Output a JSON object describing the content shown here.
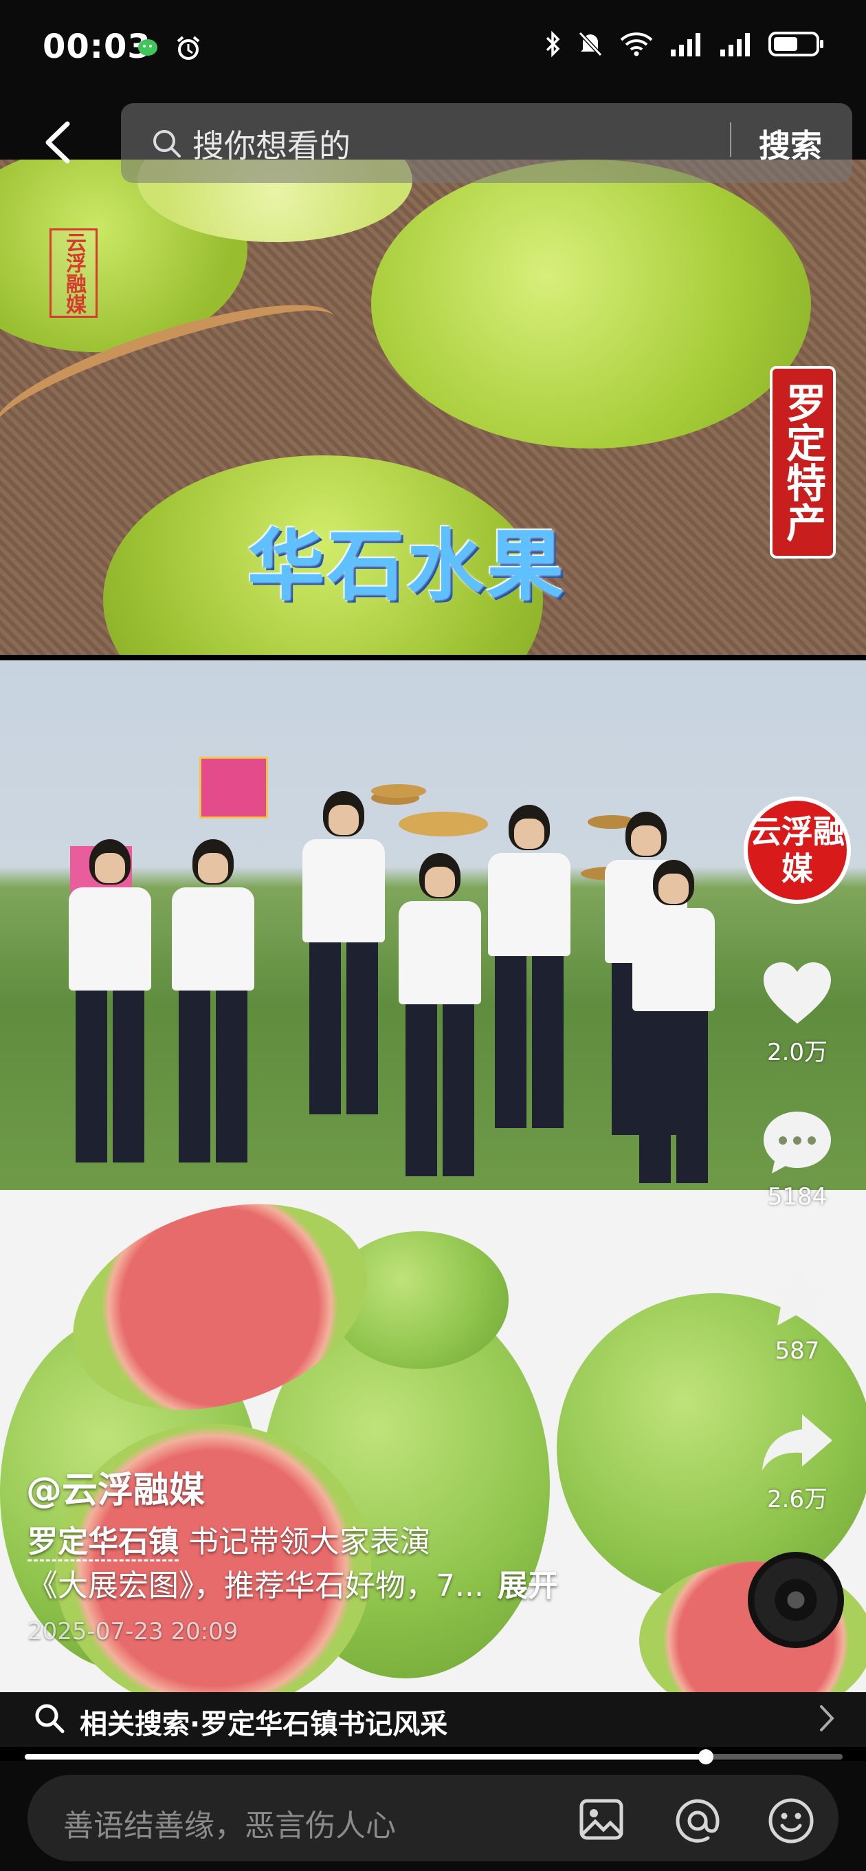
{
  "status_bar": {
    "time": "00:03",
    "left_icons": [
      "wechat-icon",
      "alarm-icon"
    ],
    "right_icons": [
      "bluetooth-icon",
      "mute-icon",
      "wifi-icon",
      "signal-icon",
      "signal-icon",
      "battery-icon"
    ]
  },
  "header": {
    "search_placeholder": "搜你想看的",
    "search_button": "搜索"
  },
  "video": {
    "watermark": "云浮融媒",
    "tag_banner": "罗定特产",
    "overlay_title": "华石水果",
    "author": "@云浮融媒",
    "caption_link": "罗定华石镇",
    "caption_line1": "书记带领大家表演",
    "caption_line2": "《大展宏图》，推荐华石好物，7...",
    "caption_expand": "展开",
    "timestamp": "2025-07-23 20:09"
  },
  "actions": {
    "avatar_label": "云浮融媒",
    "likes": "2.0万",
    "comments": "5184",
    "favorites": "587",
    "shares": "2.6万"
  },
  "related_search": {
    "prefix": "相关搜索·",
    "query": "罗定华石镇书记风采"
  },
  "progress": {
    "fraction": 0.833
  },
  "comment_bar": {
    "placeholder": "善语结善缘，恶言伤人心"
  }
}
